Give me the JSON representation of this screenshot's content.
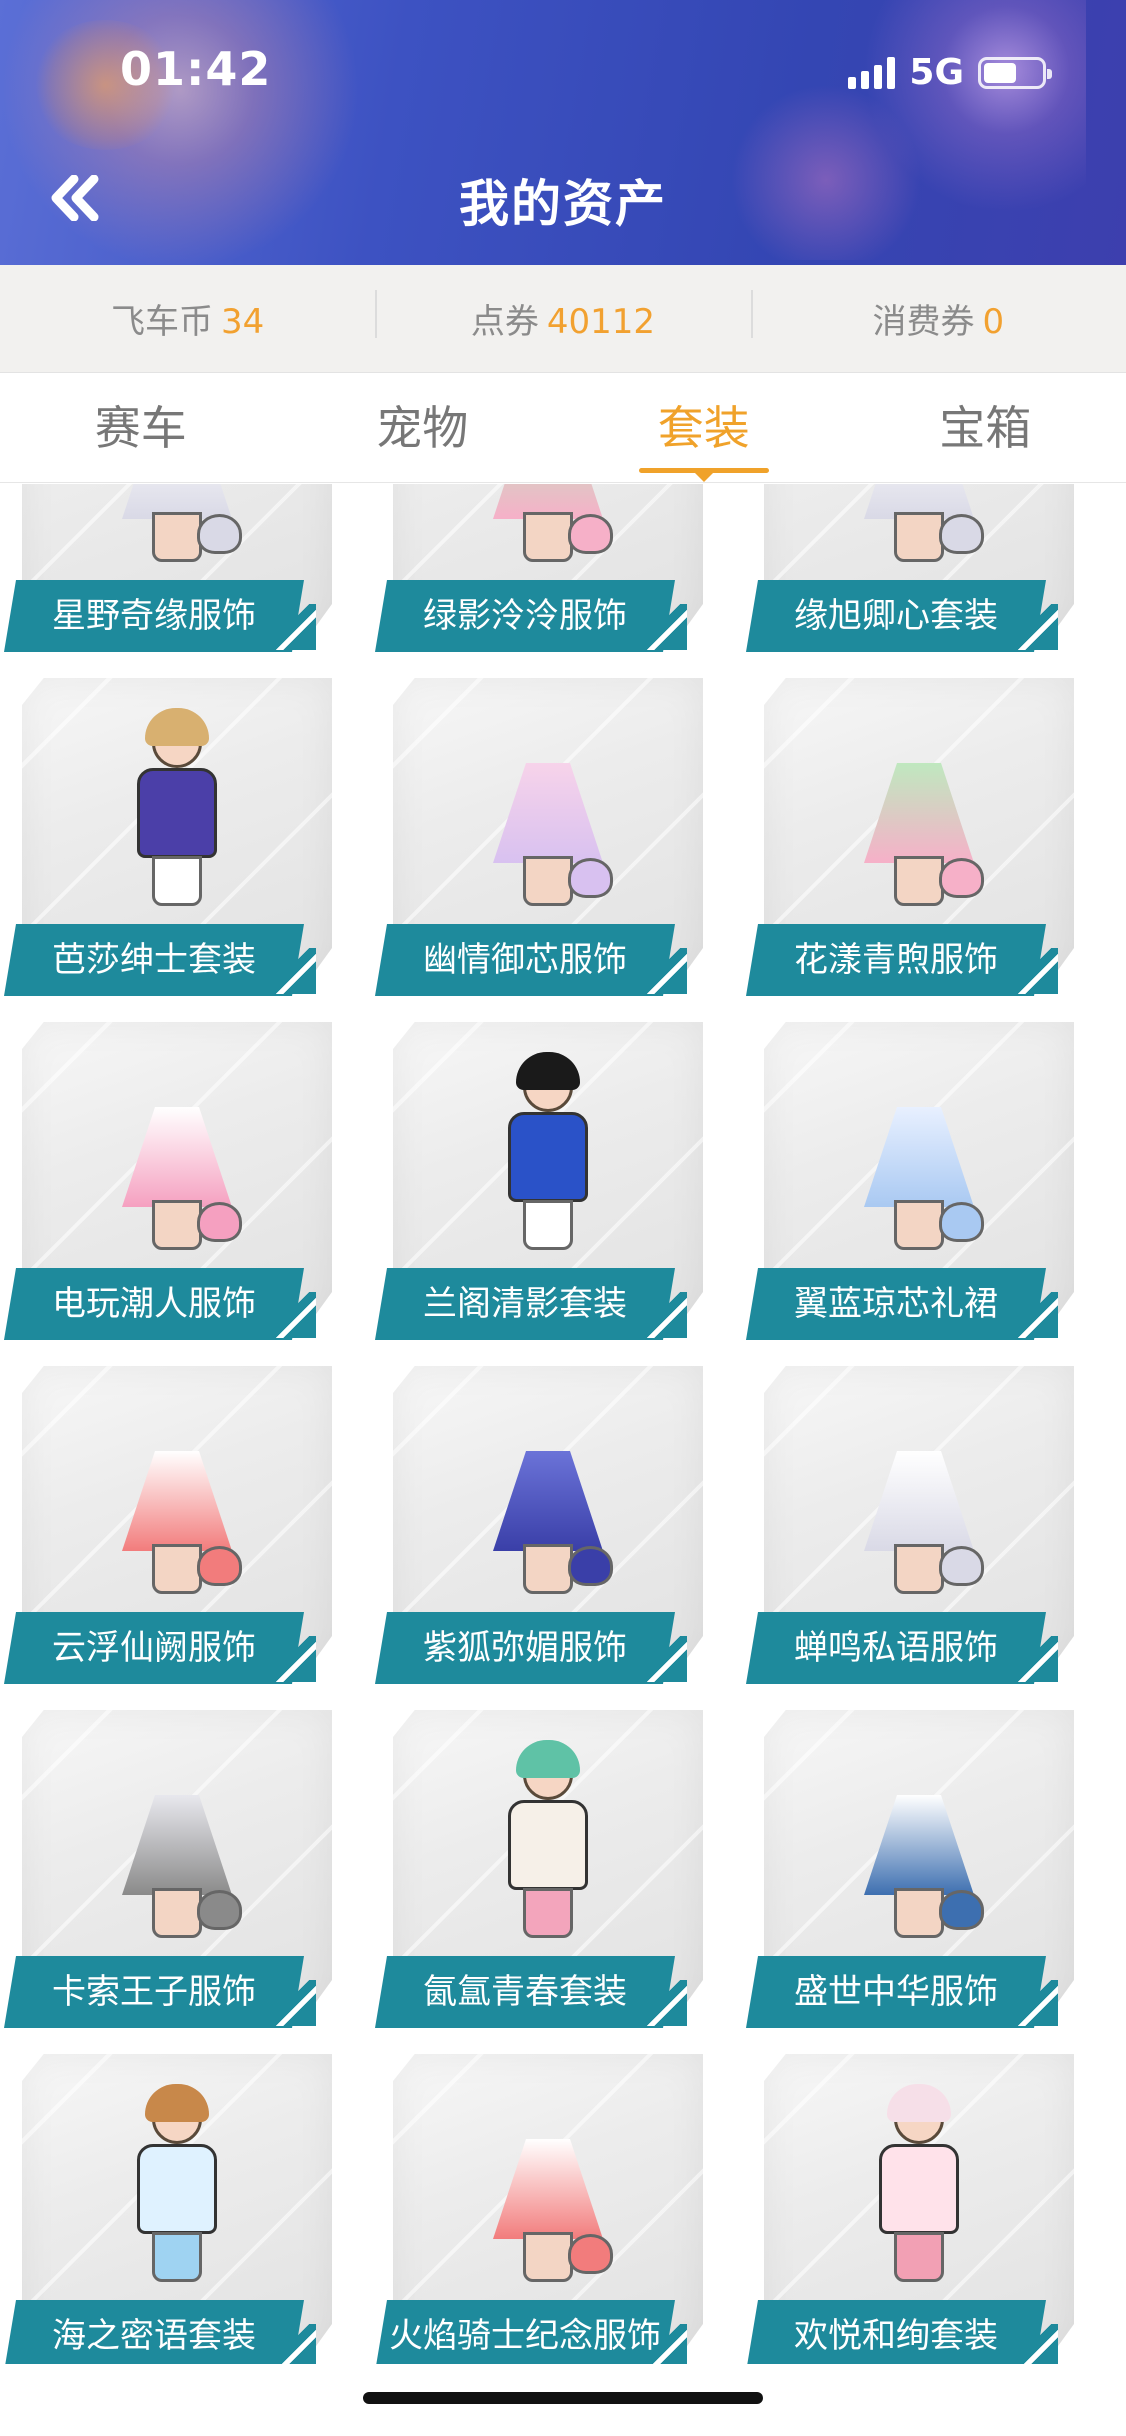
{
  "status_bar": {
    "time": "01:42",
    "network": "5G"
  },
  "header": {
    "title": "我的资产"
  },
  "balances": [
    {
      "label": "飞车币",
      "value": "34"
    },
    {
      "label": "点券",
      "value": "40112"
    },
    {
      "label": "消费券",
      "value": "0"
    }
  ],
  "tabs": [
    {
      "label": "赛车",
      "active": false
    },
    {
      "label": "宠物",
      "active": false
    },
    {
      "label": "套装",
      "active": true
    },
    {
      "label": "宝箱",
      "active": false
    }
  ],
  "items": [
    {
      "name": "星野奇缘服饰",
      "style": "dress-white"
    },
    {
      "name": "绿影泠泠服饰",
      "style": "dress-green"
    },
    {
      "name": "缘旭卿心套装",
      "style": "dress-white"
    },
    {
      "name": "芭莎绅士套装",
      "style": "boy-purple"
    },
    {
      "name": "幽情御芯服饰",
      "style": "dress-pink"
    },
    {
      "name": "花漾青煦服饰",
      "style": "dress-green"
    },
    {
      "name": "电玩潮人服饰",
      "style": "outfit-pink"
    },
    {
      "name": "兰阁清影套装",
      "style": "boy-blue"
    },
    {
      "name": "翼蓝琼芯礼裙",
      "style": "dress-lightblue"
    },
    {
      "name": "云浮仙阙服饰",
      "style": "dress-red"
    },
    {
      "name": "紫狐弥媚服饰",
      "style": "dress-purple"
    },
    {
      "name": "蝉鸣私语服饰",
      "style": "dress-white"
    },
    {
      "name": "卡索王子服饰",
      "style": "outfit-white"
    },
    {
      "name": "氤氲青春套装",
      "style": "girl-green"
    },
    {
      "name": "盛世中华服饰",
      "style": "outfit-denim"
    },
    {
      "name": "海之密语套装",
      "style": "girl-blue"
    },
    {
      "name": "火焰骑士纪念服饰",
      "style": "dress-red"
    },
    {
      "name": "欢悦和绚套装",
      "style": "girl-pink"
    }
  ],
  "colors": {
    "accent": "#f0a22a",
    "label_bg": "#1e8a9c",
    "header_bg": "#3d52c2",
    "balance_value": "#f2a130"
  },
  "icons": {
    "back": "double-chevron-left-icon"
  }
}
